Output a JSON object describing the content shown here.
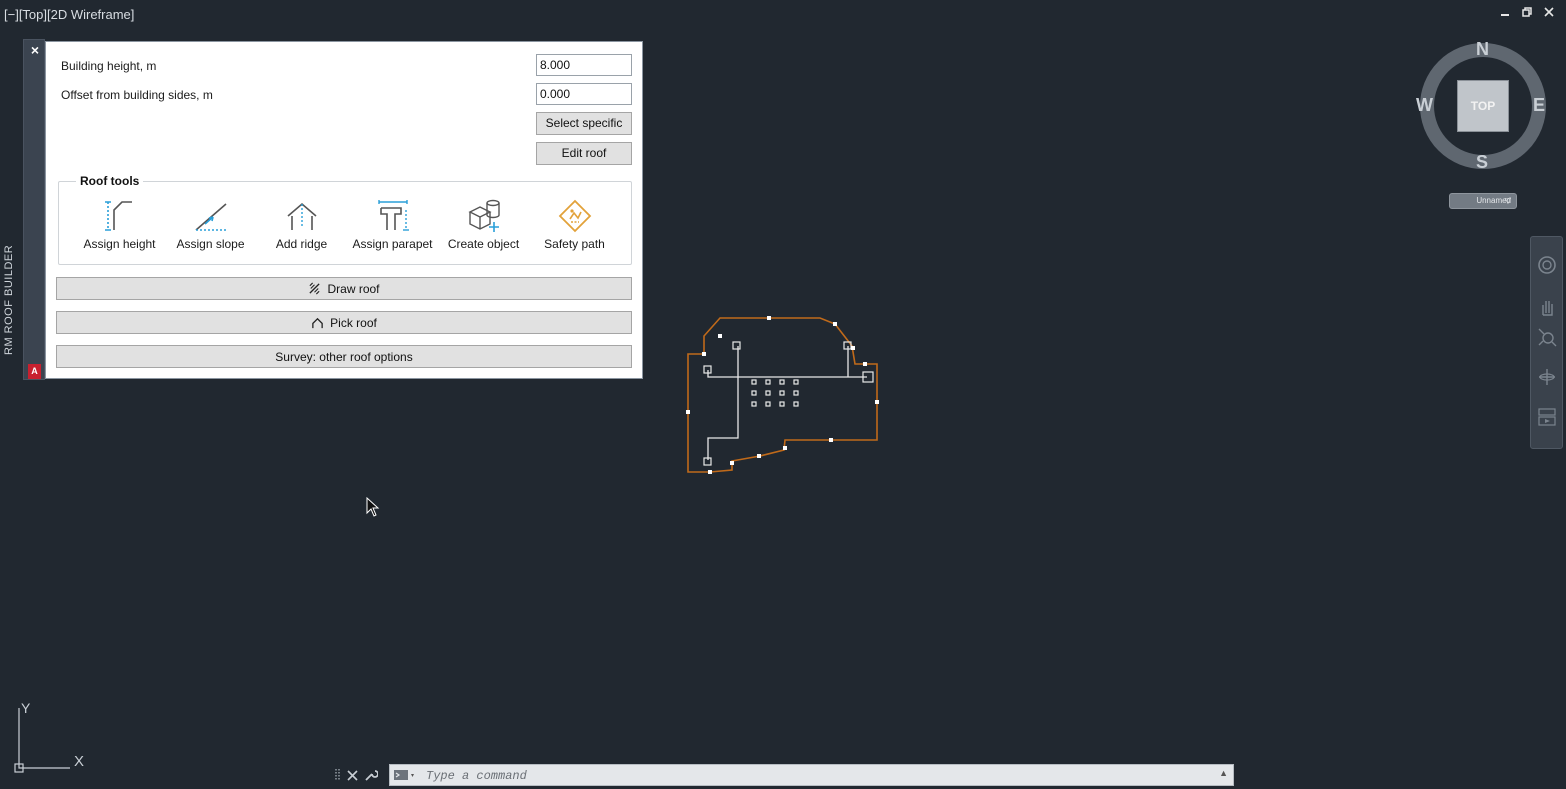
{
  "viewport": {
    "label": "[−][Top][2D Wireframe]"
  },
  "window_controls": {
    "minimize": "🗕",
    "restore": "🗗",
    "close": "✕"
  },
  "palette": {
    "close_glyph": "×",
    "title": "RM ROOF BUILDER",
    "logo_text": "A",
    "building_height_label": "Building height, m",
    "building_height_value": "8.000",
    "offset_label": "Offset from building sides, m",
    "offset_value": "0.000",
    "select_specific_label": "Select specific",
    "edit_roof_label": "Edit roof",
    "roof_tools_title": "Roof tools",
    "tools": [
      {
        "label": "Assign height",
        "icon": "assign-height-icon"
      },
      {
        "label": "Assign slope",
        "icon": "assign-slope-icon"
      },
      {
        "label": "Add ridge",
        "icon": "add-ridge-icon"
      },
      {
        "label": "Assign parapet",
        "icon": "assign-parapet-icon"
      },
      {
        "label": "Create object",
        "icon": "create-object-icon"
      },
      {
        "label": "Safety path",
        "icon": "safety-path-icon"
      }
    ],
    "draw_roof_label": "Draw roof",
    "pick_roof_label": "Pick roof",
    "survey_label": "Survey: other roof options"
  },
  "viewcube": {
    "north": "N",
    "south": "S",
    "east": "E",
    "west": "W",
    "face": "TOP",
    "ucs_menu": "Unnamed"
  },
  "ucs_icon": {
    "x": "X",
    "y": "Y"
  },
  "command_line": {
    "placeholder": "Type a command"
  },
  "colors": {
    "background": "#212830",
    "roof_outline": "#c06a1a",
    "accent_blue": "#2a9fd8",
    "safety_orange": "#e2a23a"
  }
}
